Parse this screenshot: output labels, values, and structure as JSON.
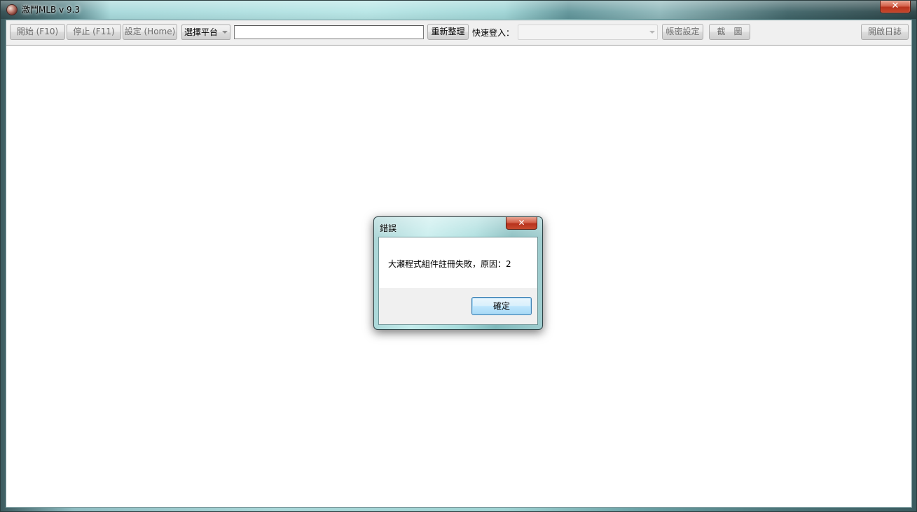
{
  "window": {
    "title": "激鬥MLB v 9.3",
    "close_label": "✕"
  },
  "toolbar": {
    "start_label": "開始 (F10)",
    "stop_label": "停止 (F11)",
    "settings_label": "設定 (Home)",
    "platform_select": "選擇平台",
    "search_value": "",
    "refresh_label": "重新整理",
    "quick_login_label": "快速登入：",
    "quick_login_value": "",
    "account_settings_label": "帳密設定",
    "screenshot_label": "截　圖",
    "open_log_label": "開啟日誌"
  },
  "dialog": {
    "title": "錯誤",
    "close_label": "✕",
    "message": "大瀬程式組件註冊失敗，原因：2",
    "ok_label": "確定"
  },
  "colors": {
    "close_red": "#c6492d",
    "ok_blue": "#3c7fb1",
    "glass_teal": "#a7d9db"
  }
}
